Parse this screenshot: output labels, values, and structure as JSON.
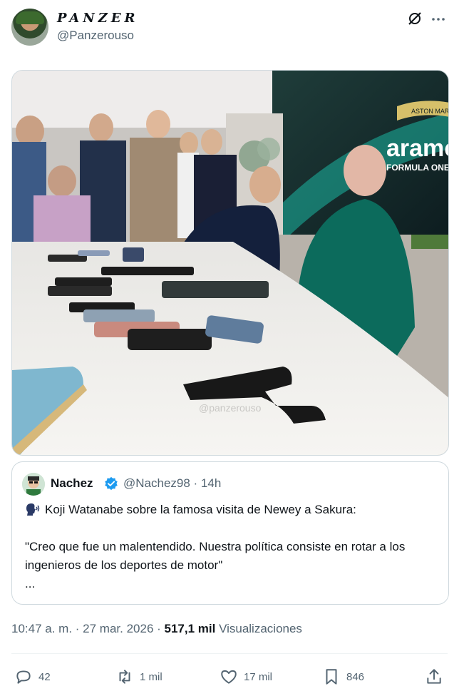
{
  "author": {
    "name": "PANZER",
    "handle": "@Panzerouso"
  },
  "header_icons": {
    "grok": "grok-icon",
    "more": "more-icon"
  },
  "photo": {
    "watermark": "@panzerouso",
    "sign_text": "aramc",
    "sign_sub": "FORMULA ONE T",
    "badge_text": "ASTON MARTIN"
  },
  "quote": {
    "name": "Nachez",
    "handle_time": "@Nachez98 · 14h",
    "line1": "Koji Watanabe sobre la famosa visita de Newey a Sakura:",
    "body": "\"Creo que fue un malentendido. Nuestra política consiste en rotar a los ingenieros de los deportes de motor\"",
    "ellipsis": "..."
  },
  "meta": {
    "time": "10:47 a. m. · 27 mar. 2026 · ",
    "views_count": "517,1 mil",
    "views_label": " Visualizaciones"
  },
  "actions": {
    "replies": "42",
    "reposts": "1 mil",
    "likes": "17 mil",
    "bookmarks": "846"
  },
  "colors": {
    "text": "#0f1419",
    "secondary": "#536471",
    "border": "#cfd9de",
    "verified": "#1d9bf0",
    "aston_green": "#0c6b5c"
  }
}
